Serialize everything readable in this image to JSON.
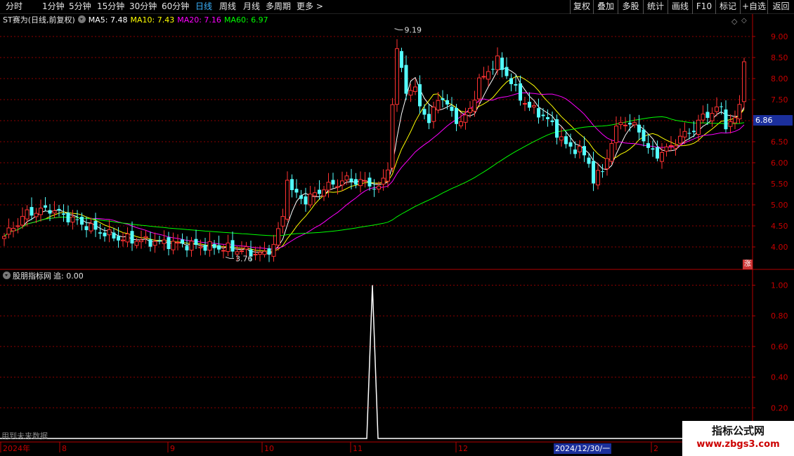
{
  "toolbar": {
    "periods": [
      {
        "label": "分时",
        "active": false
      },
      {
        "label": "1分钟",
        "active": false
      },
      {
        "label": "5分钟",
        "active": false
      },
      {
        "label": "15分钟",
        "active": false
      },
      {
        "label": "30分钟",
        "active": false
      },
      {
        "label": "60分钟",
        "active": false
      },
      {
        "label": "日线",
        "active": true
      },
      {
        "label": "周线",
        "active": false
      },
      {
        "label": "月线",
        "active": false
      },
      {
        "label": "多周期",
        "active": false
      },
      {
        "label": "更多 >",
        "active": false
      }
    ],
    "right_buttons": [
      "复权",
      "叠加",
      "多股",
      "统计",
      "画线",
      "F10",
      "标记",
      "+自选",
      "返回"
    ]
  },
  "main_title": {
    "stock": "ST赛为(日线,前复权)",
    "items": [
      {
        "text": "MA5: 7.48",
        "color": "#ffffff"
      },
      {
        "text": "MA10: 7.43",
        "color": "#ffff00"
      },
      {
        "text": "MA20: 7.16",
        "color": "#ff00ff"
      },
      {
        "text": "MA60: 6.97",
        "color": "#00ff00"
      }
    ]
  },
  "indicator_title": {
    "name": "股朋指标网",
    "value_text": "追: 0.00"
  },
  "price_tag": "6.86",
  "zhang_badge": "涨",
  "future_note": "用到未来数据",
  "date_badge": "2024/12/30/一",
  "watermark": {
    "line1": "指标公式网",
    "line2": "www.zbgs3.com"
  },
  "colors": {
    "up": "#ff3232",
    "down": "#54ffff",
    "ma5": "#ffffff",
    "ma10": "#ffff00",
    "ma20": "#ff00ff",
    "ma60": "#00ff00",
    "grid": "#8c0000",
    "axis_text": "#c80000",
    "indicator": "#ffffff"
  },
  "chart_data": [
    {
      "type": "candlestick",
      "title": "ST赛为(日线,前复权)",
      "x_labels": [
        "2024年",
        "8",
        "9",
        "10",
        "11",
        "12",
        "2"
      ],
      "y_ticks": [
        4.0,
        4.5,
        5.0,
        5.5,
        6.0,
        6.5,
        7.0,
        7.5,
        8.0,
        8.5,
        9.0
      ],
      "y_tick_labels": [
        "4.00",
        "4.50",
        "5.00",
        "5.50",
        "6.00",
        "6.50",
        "7.00",
        "7.50",
        "8.00",
        "8.50",
        "9.00"
      ],
      "ylim": [
        3.3,
        9.35
      ],
      "annotations": [
        {
          "label": "9.19",
          "value": 9.19
        },
        {
          "label": "3.76",
          "value": 3.76
        }
      ],
      "series": [
        {
          "name": "MA5",
          "last": 7.48
        },
        {
          "name": "MA10",
          "last": 7.43
        },
        {
          "name": "MA20",
          "last": 7.16
        },
        {
          "name": "MA60",
          "last": 6.97
        }
      ]
    },
    {
      "type": "line",
      "title": "股朋指标网",
      "y_ticks": [
        0.2,
        0.4,
        0.6,
        0.8,
        1.0
      ],
      "y_tick_labels": [
        "0.20",
        "0.40",
        "0.60",
        "0.80",
        "1.00"
      ],
      "ylim": [
        0,
        1.05
      ],
      "peak": {
        "value": 1.0,
        "period": "11"
      },
      "last_value": 0.0
    }
  ]
}
